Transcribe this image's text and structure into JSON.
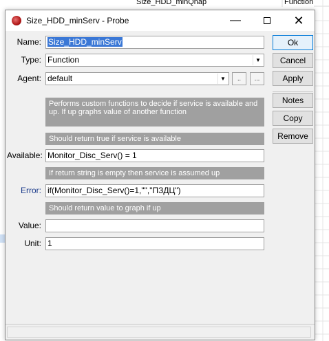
{
  "background": {
    "cell_name": "Size_HDD_minQnap",
    "cell_type": "Function"
  },
  "window": {
    "title": "Size_HDD_minServ - Probe",
    "icon": "probe-app-icon",
    "controls": {
      "minimize_glyph": "—",
      "close_glyph": "✕"
    }
  },
  "form": {
    "name_label": "Name:",
    "name_value": "Size_HDD_minServ",
    "type_label": "Type:",
    "type_value": "Function",
    "agent_label": "Agent:",
    "agent_value": "default",
    "agent_btn1": "..",
    "agent_btn2": "...",
    "description": "Performs custom functions to decide if service is available and up. If up graphs value of another function",
    "available_hint": "Should return true if service is available",
    "available_label": "Available:",
    "available_value": "Monitor_Disc_Serv() = 1",
    "error_hint": "If return string is empty then service is assumed up",
    "error_label": "Error:",
    "error_value": "if(Monitor_Disc_Serv()=1,\"\",\"ПЗДЦ\")",
    "value_hint": "Should return value to graph if up",
    "value_label": "Value:",
    "value_value": "",
    "unit_label": "Unit:",
    "unit_value": "1"
  },
  "buttons": {
    "ok": "Ok",
    "cancel": "Cancel",
    "apply": "Apply",
    "notes": "Notes",
    "copy": "Copy",
    "remove": "Remove"
  },
  "colors": {
    "accent": "#0078d7",
    "selection": "#3b78d6",
    "hint_band": "#a0a0a0",
    "error_label": "#1a3a8a"
  }
}
